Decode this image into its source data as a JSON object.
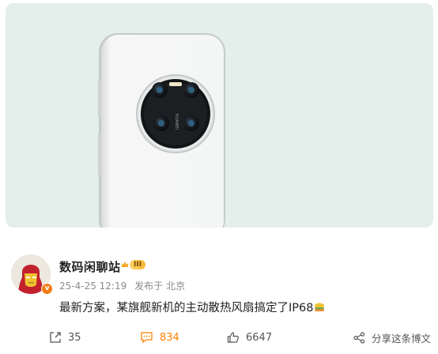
{
  "post": {
    "username": "数码闲聊站",
    "level_badge": "III",
    "timestamp": "25-4-25 12:19",
    "location_prefix": "发布于",
    "location": "北京",
    "text": "最新方案，某旗舰新机的主动散热风扇搞定了IP68",
    "verified_badge": "v",
    "image": {
      "description_icon": "phone-camera-photo-icon",
      "camera_brand_text": "HUAWEI"
    }
  },
  "actions": {
    "share_count": "35",
    "comment_count": "834",
    "like_count": "6647",
    "share_post_label": "分享这条博文"
  },
  "colors": {
    "accent": "#ff8200",
    "hero_bg": "#e4efec",
    "meta_text": "#8a8a8a"
  }
}
